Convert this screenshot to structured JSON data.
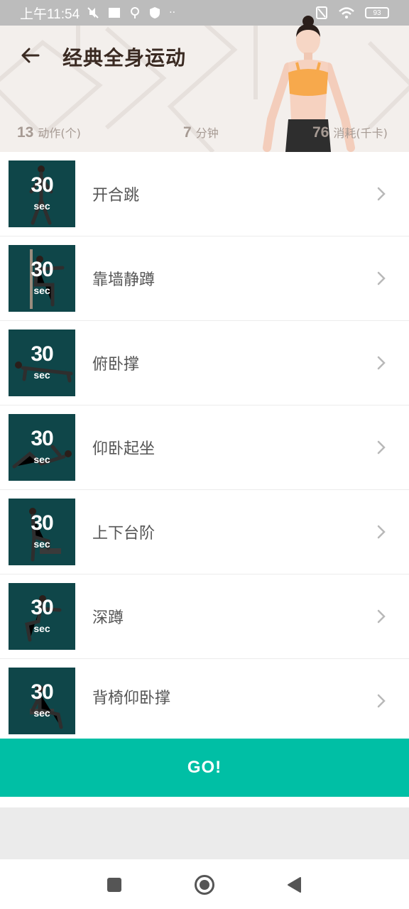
{
  "status_bar": {
    "time": "上午11:54",
    "battery": "93"
  },
  "header": {
    "title": "经典全身运动",
    "stats": [
      {
        "value": "13",
        "unit": "动作(个)"
      },
      {
        "value": "7",
        "unit": "分钟"
      },
      {
        "value": "76",
        "unit": "消耗(千卡)"
      }
    ]
  },
  "exercises": [
    {
      "name": "开合跳",
      "duration": "30",
      "duration_unit": "sec"
    },
    {
      "name": "靠墙静蹲",
      "duration": "30",
      "duration_unit": "sec"
    },
    {
      "name": "俯卧撑",
      "duration": "30",
      "duration_unit": "sec"
    },
    {
      "name": "仰卧起坐",
      "duration": "30",
      "duration_unit": "sec"
    },
    {
      "name": "上下台阶",
      "duration": "30",
      "duration_unit": "sec"
    },
    {
      "name": "深蹲",
      "duration": "30",
      "duration_unit": "sec"
    },
    {
      "name": "背椅仰卧撑",
      "duration": "30",
      "duration_unit": "sec"
    }
  ],
  "go_button": {
    "label": "GO!"
  },
  "colors": {
    "accent": "#00bfa5",
    "thumb_bg": "#0f4649",
    "header_bg": "#f3efec"
  },
  "icons": {
    "back": "arrow-left-icon",
    "chevron": "chevron-right-icon",
    "nav_recent": "square-icon",
    "nav_home": "circle-icon",
    "nav_back": "triangle-left-icon"
  }
}
